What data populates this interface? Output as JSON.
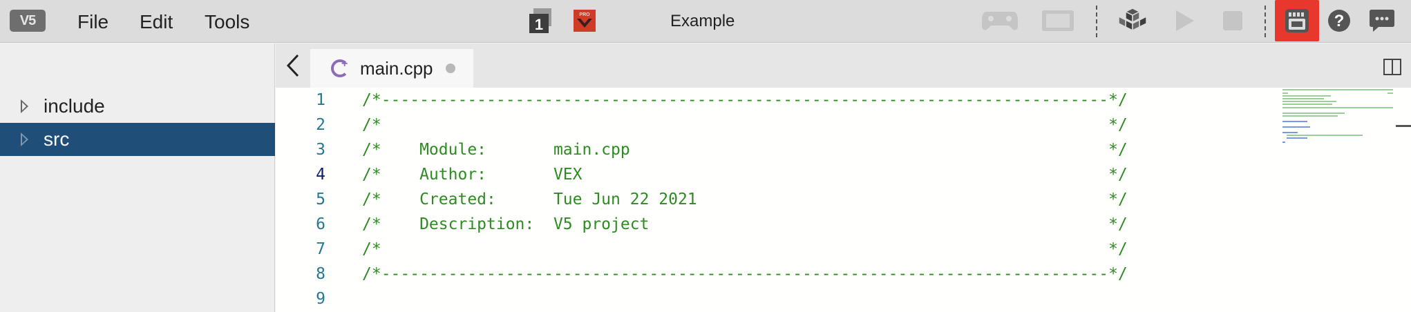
{
  "app": {
    "logo_text": "V5",
    "title": "Example"
  },
  "menu": [
    {
      "label": "File"
    },
    {
      "label": "Edit"
    },
    {
      "label": "Tools"
    }
  ],
  "toolbar": {
    "slot_number": "1",
    "pro_badge": "PRO",
    "icons": [
      "controller-icon",
      "brain-screen-icon",
      "build-icon",
      "run-icon",
      "stop-icon",
      "device-info-icon",
      "help-icon",
      "feedback-icon"
    ],
    "highlight_color": "#e8372c"
  },
  "sidebar": {
    "items": [
      {
        "label": "include",
        "selected": false
      },
      {
        "label": "src",
        "selected": true
      }
    ]
  },
  "tabs": [
    {
      "label": "main.cpp",
      "modified": true
    }
  ],
  "editor": {
    "lines": [
      {
        "n": "1",
        "text": "/*----------------------------------------------------------------------------*/"
      },
      {
        "n": "2",
        "text": "/*                                                                            */"
      },
      {
        "n": "3",
        "text": "/*    Module:       main.cpp                                                  */"
      },
      {
        "n": "4",
        "text": "/*    Author:       VEX                                                       */"
      },
      {
        "n": "5",
        "text": "/*    Created:      Tue Jun 22 2021                                           */"
      },
      {
        "n": "6",
        "text": "/*    Description:  V5 project                                                */"
      },
      {
        "n": "7",
        "text": "/*                                                                            */"
      },
      {
        "n": "8",
        "text": "/*----------------------------------------------------------------------------*/"
      },
      {
        "n": "9",
        "text": ""
      }
    ],
    "active_line": "4",
    "comment_color": "#2e8b22",
    "line_number_color": "#237893"
  }
}
